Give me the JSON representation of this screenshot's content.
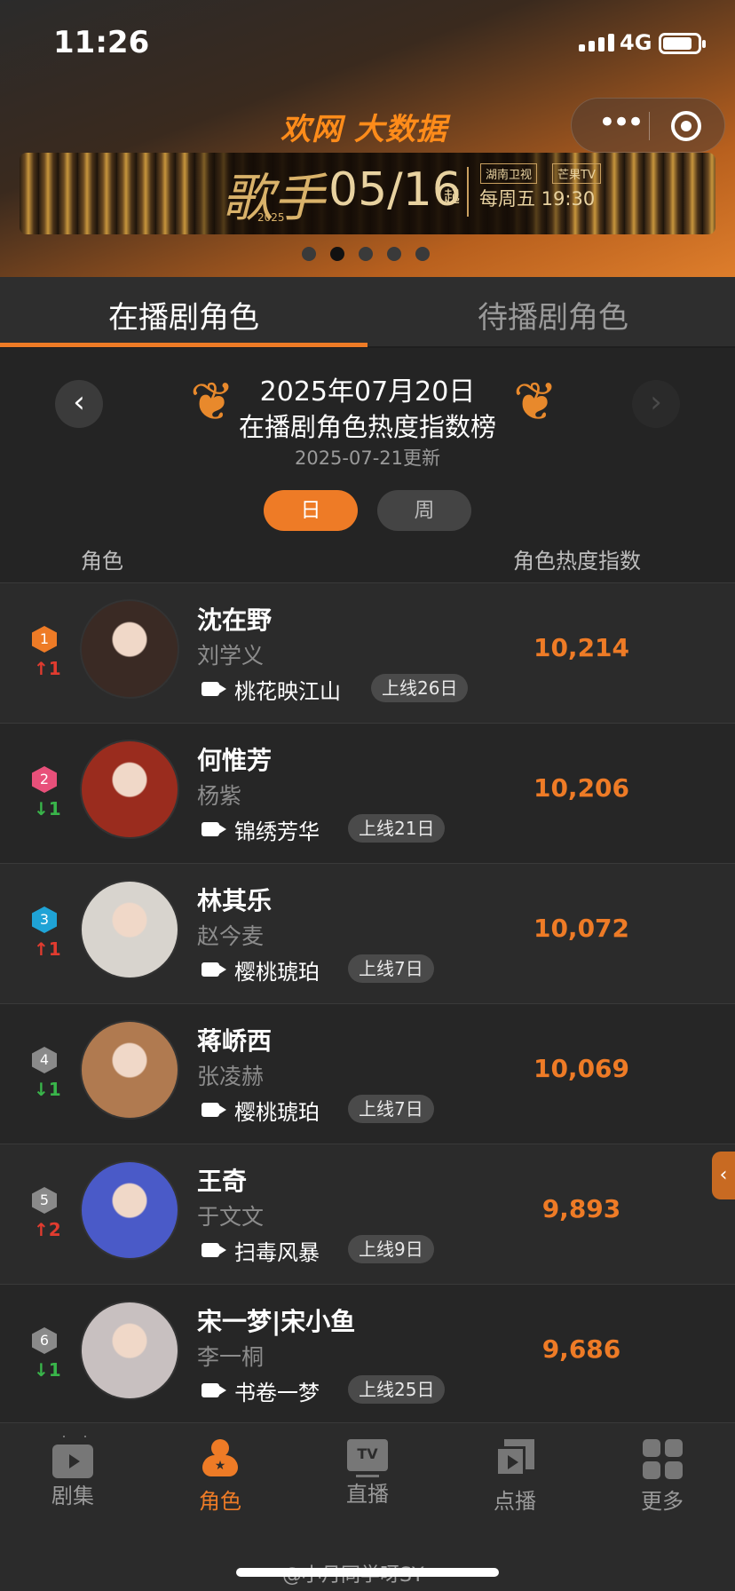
{
  "status_bar": {
    "time": "11:26",
    "network": "4G"
  },
  "header": {
    "logo": "欢网 大数据"
  },
  "banner": {
    "show": "歌手",
    "year": "2025",
    "date": "05/16",
    "suffix": "起",
    "channel1": "湖南卫视",
    "channel2": "芒果TV",
    "airtime": "每周五 19:30",
    "carousel_total": 5,
    "carousel_active": 2
  },
  "tabs": [
    {
      "label": "在播剧角色",
      "active": true
    },
    {
      "label": "待播剧角色",
      "active": false
    }
  ],
  "ranking": {
    "date": "2025年07月20日",
    "title": "在播剧角色热度指数榜",
    "updated": "2025-07-21更新",
    "period_day": "日",
    "period_week": "周",
    "col_role": "角色",
    "col_index": "角色热度指数"
  },
  "rows": [
    {
      "rank": "1",
      "change": "↑1",
      "dir": "up",
      "badge_color": "#ee7b26",
      "name": "沈在野",
      "actor": "刘学义",
      "drama": "桃花映江山",
      "days": "上线26日",
      "score": "10,214",
      "avatar_color": "#3a2a24"
    },
    {
      "rank": "2",
      "change": "↓1",
      "dir": "down",
      "badge_color": "#e8507a",
      "name": "何惟芳",
      "actor": "杨紫",
      "drama": "锦绣芳华",
      "days": "上线21日",
      "score": "10,206",
      "avatar_color": "#9a2c1e"
    },
    {
      "rank": "3",
      "change": "↑1",
      "dir": "up",
      "badge_color": "#1fa3d6",
      "name": "林其乐",
      "actor": "赵今麦",
      "drama": "樱桃琥珀",
      "days": "上线7日",
      "score": "10,072",
      "avatar_color": "#d8d4ce"
    },
    {
      "rank": "4",
      "change": "↓1",
      "dir": "down",
      "badge_color": "#8a8a8a",
      "name": "蒋峤西",
      "actor": "张凌赫",
      "drama": "樱桃琥珀",
      "days": "上线7日",
      "score": "10,069",
      "avatar_color": "#b07a50"
    },
    {
      "rank": "5",
      "change": "↑2",
      "dir": "up",
      "badge_color": "#8a8a8a",
      "name": "王奇",
      "actor": "于文文",
      "drama": "扫毒风暴",
      "days": "上线9日",
      "score": "9,893",
      "avatar_color": "#4a5ac8"
    },
    {
      "rank": "6",
      "change": "↓1",
      "dir": "down",
      "badge_color": "#8a8a8a",
      "name": "宋一梦|宋小鱼",
      "actor": "李一桐",
      "drama": "书卷一梦",
      "days": "上线25日",
      "score": "9,686",
      "avatar_color": "#c8c0c0"
    }
  ],
  "bottom_nav": [
    {
      "label": "剧集",
      "icon": "tv-icon",
      "active": false
    },
    {
      "label": "角色",
      "icon": "role-icon",
      "active": true
    },
    {
      "label": "直播",
      "icon": "live-tv-icon",
      "active": false
    },
    {
      "label": "点播",
      "icon": "vod-icon",
      "active": false
    },
    {
      "label": "更多",
      "icon": "grid-icon",
      "active": false
    }
  ],
  "watermark": "@小月同学呀SY"
}
